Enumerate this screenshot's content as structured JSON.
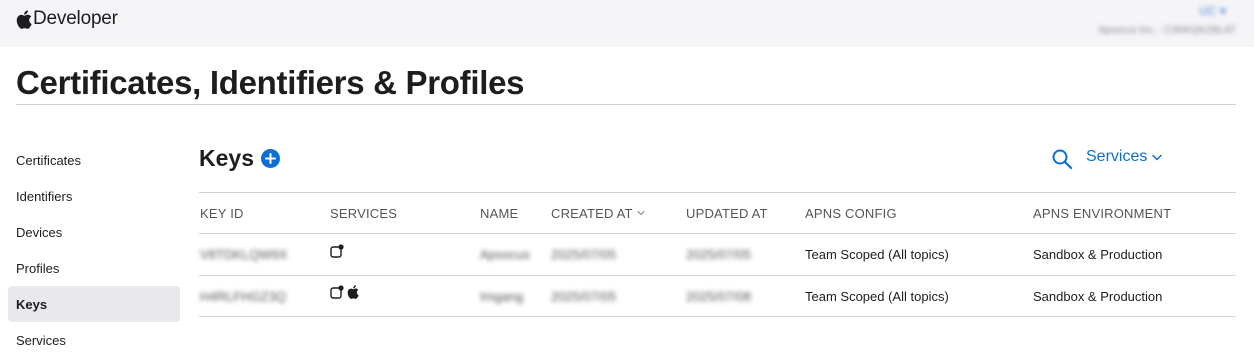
{
  "header": {
    "brand": "Developer",
    "account_top": "UC ▾",
    "account_bottom": "Apsocus Inc. - C3NKQKZBLAT"
  },
  "page_title": "Certificates, Identifiers & Profiles",
  "sidebar": {
    "items": [
      {
        "label": "Certificates"
      },
      {
        "label": "Identifiers"
      },
      {
        "label": "Devices"
      },
      {
        "label": "Profiles"
      },
      {
        "label": "Keys",
        "active": true
      },
      {
        "label": "Services"
      }
    ]
  },
  "section": {
    "title": "Keys",
    "services_label": "Services"
  },
  "table": {
    "headers": [
      "KEY ID",
      "SERVICES",
      "NAME",
      "CREATED AT",
      "UPDATED AT",
      "APNS CONFIG",
      "APNS ENVIRONMENT"
    ],
    "rows": [
      {
        "key_id": "V8TDKLQW9X",
        "services": [
          "apns-icon"
        ],
        "name": "Apsocus",
        "created_at": "2025/07/05",
        "updated_at": "2025/07/05",
        "apns_config": "Team Scoped (All topics)",
        "apns_environment": "Sandbox & Production"
      },
      {
        "key_id": "H4RLFHGZ3Q",
        "services": [
          "apns-icon",
          "sign-in-with-apple-icon"
        ],
        "name": "Imgang",
        "created_at": "2025/07/05",
        "updated_at": "2025/07/08",
        "apns_config": "Team Scoped (All topics)",
        "apns_environment": "Sandbox & Production"
      }
    ]
  },
  "colors": {
    "accent": "#0b6fd6",
    "topbar_bg": "#f5f5f7",
    "active_bg": "#e8e8ed",
    "border": "#d2d2d7"
  }
}
